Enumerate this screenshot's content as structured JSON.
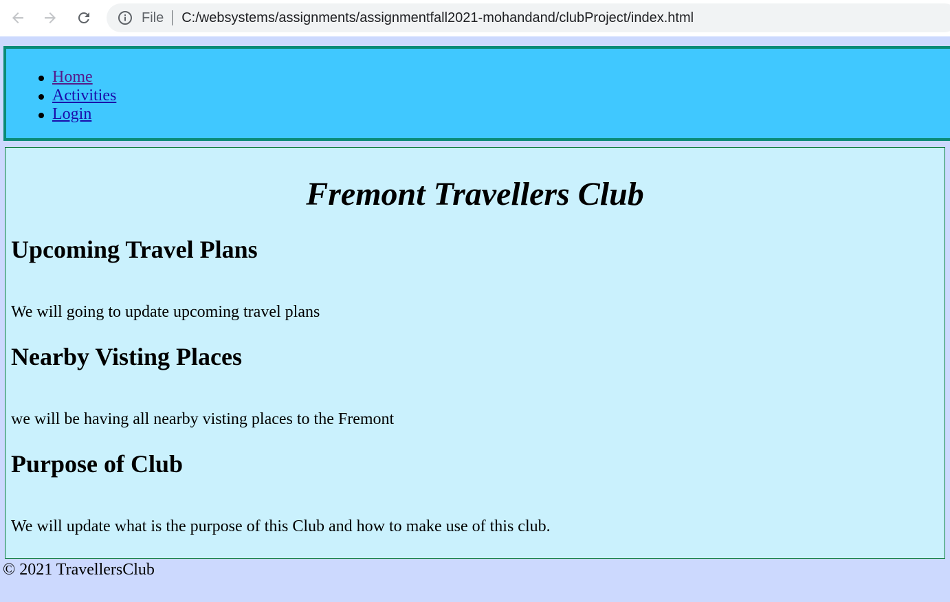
{
  "browser": {
    "back_icon": "arrow-left-icon",
    "forward_icon": "arrow-right-icon",
    "reload_icon": "reload-icon",
    "info_icon": "info-icon",
    "scheme_label": "File",
    "url": "C:/websystems/assignments/assignmentfall2021-mohandand/clubProject/index.html"
  },
  "nav": {
    "items": [
      {
        "label": "Home"
      },
      {
        "label": "Activities"
      },
      {
        "label": "Login"
      }
    ]
  },
  "main": {
    "title": "Fremont Travellers Club",
    "sections": [
      {
        "heading": "Upcoming Travel Plans",
        "text": "We will going to update upcoming travel plans"
      },
      {
        "heading": "Nearby Visting Places",
        "text": "we will be having all nearby visting places to the Fremont"
      },
      {
        "heading": "Purpose of Club",
        "text": "We will update what is the purpose of this Club and how to make use of this club."
      }
    ]
  },
  "footer": {
    "text": "© 2021 TravellersClub"
  },
  "colors": {
    "page_background": "#ccd9fe",
    "nav_background": "#40c8ff",
    "nav_border": "#0a8b77",
    "main_background": "#caf1fd",
    "main_border": "#0a7a3c",
    "link": "#1a0dab",
    "link_visited": "#551a8b"
  }
}
